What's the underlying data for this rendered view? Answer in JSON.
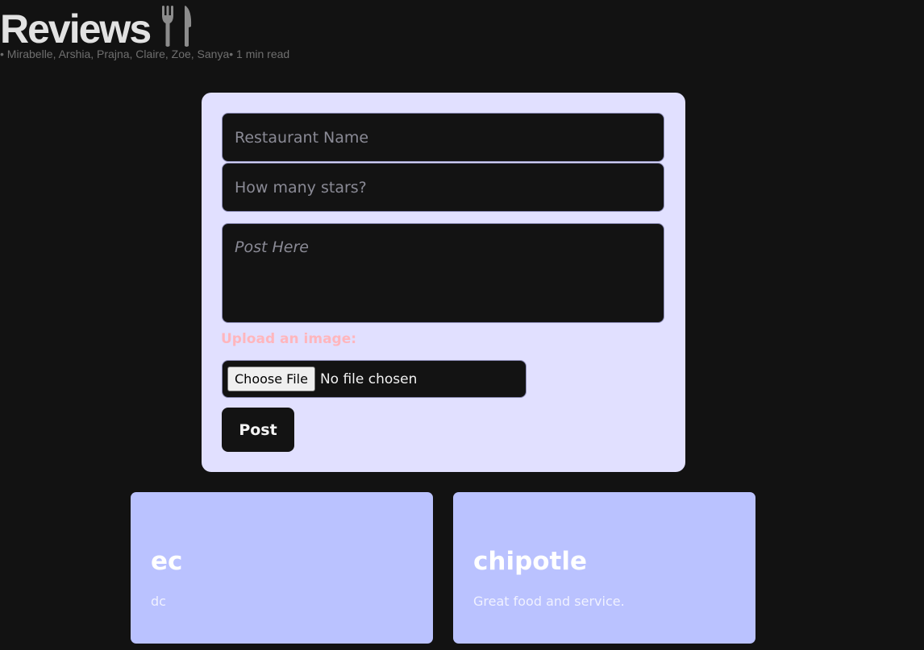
{
  "header": {
    "title": "Reviews",
    "title_icon": "fork-knife-icon",
    "byline": "• Mirabelle, Arshia, Prajna, Claire, Zoe, Sanya• 1 min read"
  },
  "form": {
    "restaurant_placeholder": "Restaurant Name",
    "restaurant_value": "",
    "stars_placeholder": "How many stars?",
    "stars_value": "",
    "post_placeholder": "Post Here",
    "post_value": "",
    "upload_label": "Upload an image:",
    "choose_file_label": "Choose File",
    "file_status": "No file chosen",
    "post_button_label": "Post"
  },
  "reviews": [
    {
      "title": "ec",
      "text": "dc"
    },
    {
      "title": "chipotle",
      "text": "Great food and service."
    }
  ],
  "colors": {
    "background": "#121212",
    "form_background": "#e1e0ff",
    "card_background": "#bac2ff",
    "upload_label": "#ffb6bd"
  }
}
